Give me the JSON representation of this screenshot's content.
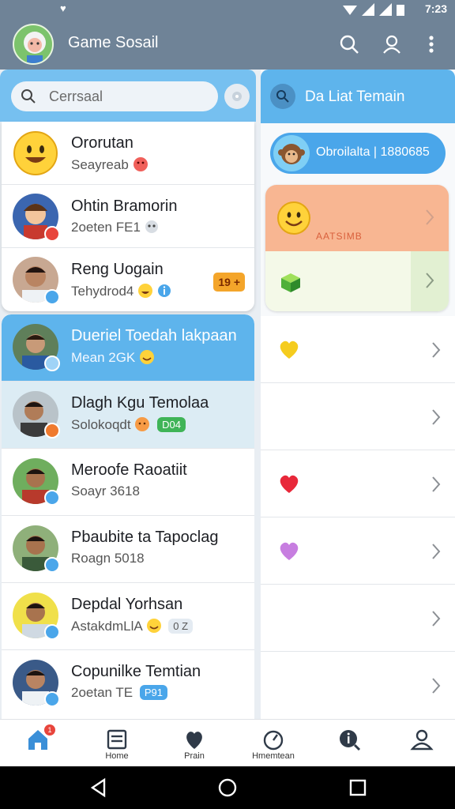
{
  "status_bar": {
    "time": "7:23"
  },
  "app_bar": {
    "title": "Game Sosail",
    "actions": [
      {
        "icon": "search-icon"
      },
      {
        "icon": "profile-icon"
      },
      {
        "icon": "more-vertical-icon"
      }
    ]
  },
  "search": {
    "placeholder": "Cerrsaal"
  },
  "chats_top": [
    {
      "name": "Ororutan",
      "sub": "Seayreab",
      "avatar": "smiley-face"
    },
    {
      "name": "Ohtin Bramorin",
      "sub": "2oeten FE1",
      "avatar": "game-character"
    },
    {
      "name": "Reng Uogain",
      "sub": "Tehydrod4",
      "avatar": "person",
      "tag": "19 +"
    }
  ],
  "chats_bottom": [
    {
      "name": "Dueriel Toedah lakpaan",
      "sub": "Mean 2GK",
      "state": "active"
    },
    {
      "name": "Dlagh Kgu Temolaa",
      "sub": "Solokoqdt",
      "chip": "D04",
      "state": "tinted"
    },
    {
      "name": "Meroofe Raoatiit",
      "sub": "Soayr 3618"
    },
    {
      "name": "Pbaubite ta Tapoclag",
      "sub": "Roagn 5018"
    },
    {
      "name": "Depdal Yorhsan",
      "sub": "AstakdmLlA",
      "chip": "0 Z"
    },
    {
      "name": "Copunilke Temtian",
      "sub": "2oetan TE",
      "chip": "P91"
    }
  ],
  "right_panel": {
    "title": "Da Liat Temain",
    "profile_pill": "Obroilalta | 1880685",
    "feature_label": "AATSIMB",
    "rows": [
      {
        "emoji": "yellow-heart"
      },
      {
        "emoji": ""
      },
      {
        "emoji": "red-heart"
      },
      {
        "emoji": "purple-heart"
      },
      {
        "emoji": ""
      },
      {
        "emoji": ""
      }
    ]
  },
  "bottom_nav": [
    {
      "label": "",
      "icon": "home-icon",
      "badge": "1"
    },
    {
      "label": "Home",
      "icon": "news-icon"
    },
    {
      "label": "Prain",
      "icon": "heart-icon"
    },
    {
      "label": "Hmemtean",
      "icon": "compass-icon"
    },
    {
      "label": "",
      "icon": "discover-icon"
    },
    {
      "label": "",
      "icon": "person-icon"
    }
  ],
  "colors": {
    "app_bar": "#6f8397",
    "accent": "#5eb4ec",
    "feature": "#f8b692"
  }
}
